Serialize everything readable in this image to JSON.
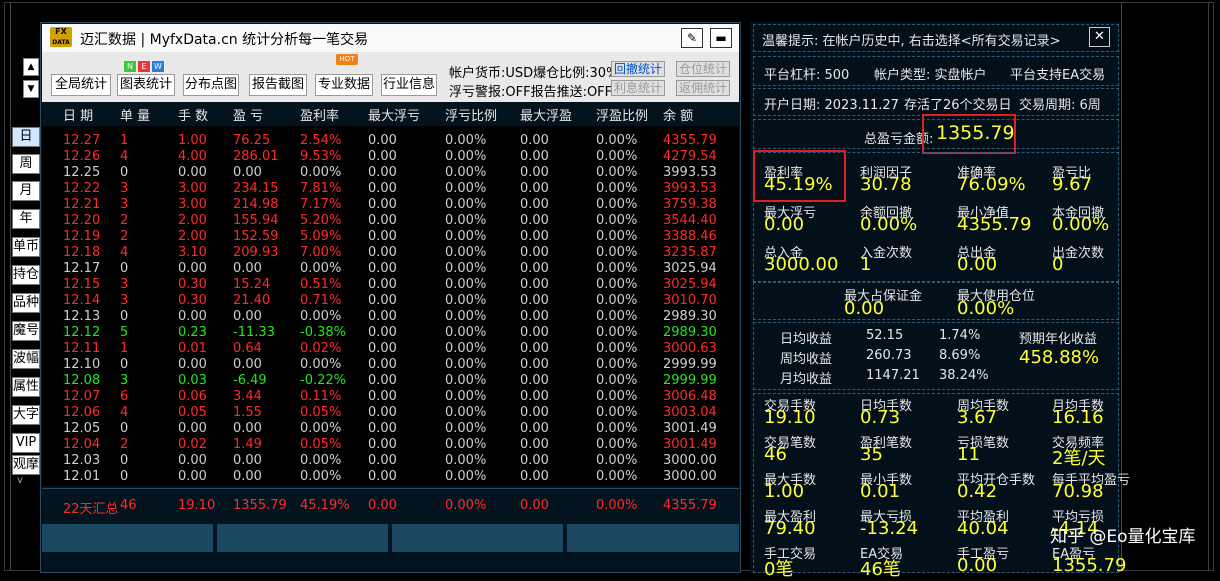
{
  "window": {
    "logo_top": "FX",
    "logo_bottom": "DATA",
    "title": "迈汇数据 | MyfxData.cn  统计分析每一笔交易",
    "edit_icon": "✎",
    "minimize_icon": "▬"
  },
  "toolbar": {
    "buttons": [
      "全局统计",
      "图表统计",
      "分布点图",
      "报告截图",
      "专业数据",
      "行业信息"
    ],
    "new_badges": [
      "N",
      "E",
      "W"
    ],
    "hot_badge": "HOT",
    "account_line1": "帐户货币:USD爆仓比例:30%",
    "account_line2": "浮亏警报:OFF报告推送:OFF",
    "btn_backtest": "回撤统计",
    "btn_position": "仓位统计",
    "btn_profit_info": "利息统计",
    "btn_commission": "返佣统计",
    "up_arrow": "▲",
    "down_arrow": "▼"
  },
  "side_tabs": [
    "日",
    "周",
    "月",
    "年",
    "单币",
    "持仓",
    "品种",
    "魔号",
    "波幅",
    "属性",
    "大字",
    "VIP",
    "观摩"
  ],
  "side_small_arrow": "v",
  "table": {
    "headers": [
      "日 期",
      "单 量",
      "手 数",
      "盈 亏",
      "盈利率",
      "最大浮亏",
      "浮亏比例",
      "最大浮盈",
      "浮盈比例",
      "余 额"
    ],
    "rows": [
      {
        "c": [
          "12.27",
          "1",
          "1.00",
          "76.25",
          "2.54%",
          "0.00",
          "0.00%",
          "0.00",
          "0.00%",
          "4355.79"
        ],
        "t": "red"
      },
      {
        "c": [
          "12.26",
          "4",
          "4.00",
          "286.01",
          "9.53%",
          "0.00",
          "0.00%",
          "0.00",
          "0.00%",
          "4279.54"
        ],
        "t": "red"
      },
      {
        "c": [
          "12.25",
          "0",
          "0.00",
          "0.00",
          "0.00%",
          "0.00",
          "0.00%",
          "0.00",
          "0.00%",
          "3993.53"
        ],
        "t": "white"
      },
      {
        "c": [
          "12.22",
          "3",
          "3.00",
          "234.15",
          "7.81%",
          "0.00",
          "0.00%",
          "0.00",
          "0.00%",
          "3993.53"
        ],
        "t": "red"
      },
      {
        "c": [
          "12.21",
          "3",
          "3.00",
          "214.98",
          "7.17%",
          "0.00",
          "0.00%",
          "0.00",
          "0.00%",
          "3759.38"
        ],
        "t": "red"
      },
      {
        "c": [
          "12.20",
          "2",
          "2.00",
          "155.94",
          "5.20%",
          "0.00",
          "0.00%",
          "0.00",
          "0.00%",
          "3544.40"
        ],
        "t": "red"
      },
      {
        "c": [
          "12.19",
          "2",
          "2.00",
          "152.59",
          "5.09%",
          "0.00",
          "0.00%",
          "0.00",
          "0.00%",
          "3388.46"
        ],
        "t": "red"
      },
      {
        "c": [
          "12.18",
          "4",
          "3.10",
          "209.93",
          "7.00%",
          "0.00",
          "0.00%",
          "0.00",
          "0.00%",
          "3235.87"
        ],
        "t": "red"
      },
      {
        "c": [
          "12.17",
          "0",
          "0.00",
          "0.00",
          "0.00%",
          "0.00",
          "0.00%",
          "0.00",
          "0.00%",
          "3025.94"
        ],
        "t": "white"
      },
      {
        "c": [
          "12.15",
          "3",
          "0.30",
          "15.24",
          "0.51%",
          "0.00",
          "0.00%",
          "0.00",
          "0.00%",
          "3025.94"
        ],
        "t": "red"
      },
      {
        "c": [
          "12.14",
          "3",
          "0.30",
          "21.40",
          "0.71%",
          "0.00",
          "0.00%",
          "0.00",
          "0.00%",
          "3010.70"
        ],
        "t": "red"
      },
      {
        "c": [
          "12.13",
          "0",
          "0.00",
          "0.00",
          "0.00%",
          "0.00",
          "0.00%",
          "0.00",
          "0.00%",
          "2989.30"
        ],
        "t": "white"
      },
      {
        "c": [
          "12.12",
          "5",
          "0.23",
          "-11.33",
          "-0.38%",
          "0.00",
          "0.00%",
          "0.00",
          "0.00%",
          "2989.30"
        ],
        "t": "green"
      },
      {
        "c": [
          "12.11",
          "1",
          "0.01",
          "0.64",
          "0.02%",
          "0.00",
          "0.00%",
          "0.00",
          "0.00%",
          "3000.63"
        ],
        "t": "red"
      },
      {
        "c": [
          "12.10",
          "0",
          "0.00",
          "0.00",
          "0.00%",
          "0.00",
          "0.00%",
          "0.00",
          "0.00%",
          "2999.99"
        ],
        "t": "white"
      },
      {
        "c": [
          "12.08",
          "3",
          "0.03",
          "-6.49",
          "-0.22%",
          "0.00",
          "0.00%",
          "0.00",
          "0.00%",
          "2999.99"
        ],
        "t": "green"
      },
      {
        "c": [
          "12.07",
          "6",
          "0.06",
          "3.44",
          "0.11%",
          "0.00",
          "0.00%",
          "0.00",
          "0.00%",
          "3006.48"
        ],
        "t": "red"
      },
      {
        "c": [
          "12.06",
          "4",
          "0.05",
          "1.55",
          "0.05%",
          "0.00",
          "0.00%",
          "0.00",
          "0.00%",
          "3003.04"
        ],
        "t": "red"
      },
      {
        "c": [
          "12.05",
          "0",
          "0.00",
          "0.00",
          "0.00%",
          "0.00",
          "0.00%",
          "0.00",
          "0.00%",
          "3001.49"
        ],
        "t": "white"
      },
      {
        "c": [
          "12.04",
          "2",
          "0.02",
          "1.49",
          "0.05%",
          "0.00",
          "0.00%",
          "0.00",
          "0.00%",
          "3001.49"
        ],
        "t": "red"
      },
      {
        "c": [
          "12.03",
          "0",
          "0.00",
          "0.00",
          "0.00%",
          "0.00",
          "0.00%",
          "0.00",
          "0.00%",
          "3000.00"
        ],
        "t": "white"
      },
      {
        "c": [
          "12.01",
          "0",
          "0.00",
          "0.00",
          "0.00%",
          "0.00",
          "0.00%",
          "0.00",
          "0.00%",
          "3000.00"
        ],
        "t": "white"
      }
    ],
    "summary": [
      "22天汇总",
      "46",
      "19.10",
      "1355.79",
      "45.19%",
      "0.00",
      "0.00%",
      "0.00",
      "0.00%",
      "4355.79"
    ]
  },
  "right": {
    "tip": "温馨提示: 在帐户历史中, 右击选择<所有交易记录>",
    "close_icon": "✕",
    "leverage": "平台杠杆: 500",
    "account_type": "帐户类型: 实盘帐户",
    "ea_support": "平台支持EA交易",
    "open_date": "开户日期: 2023.11.27",
    "survived": "存活了26个交易日",
    "trade_period": "交易周期: 6周",
    "total_pl_label": "总盈亏金额:",
    "total_pl_value": "1355.79",
    "metrics": [
      {
        "label": "盈利率",
        "value": "45.19%"
      },
      {
        "label": "利润因子",
        "value": "30.78"
      },
      {
        "label": "准确率",
        "value": "76.09%"
      },
      {
        "label": "盈亏比",
        "value": "9.67"
      },
      {
        "label": "最大浮亏",
        "value": "0.00"
      },
      {
        "label": "余额回撤",
        "value": "0.00%"
      },
      {
        "label": "最小净值",
        "value": "4355.79"
      },
      {
        "label": "本金回撤",
        "value": "0.00%"
      },
      {
        "label": "总入金",
        "value": "3000.00"
      },
      {
        "label": "入金次数",
        "value": "1"
      },
      {
        "label": "总出金",
        "value": "0.00"
      },
      {
        "label": "出金次数",
        "value": "0"
      }
    ],
    "margin_max_label": "最大占保证金",
    "margin_max_value": "0.00",
    "max_pos_label": "最大使用仓位",
    "max_pos_value": "0.00%",
    "earnings": [
      {
        "label": "日均收益",
        "amount": "52.15",
        "pct": "1.74%"
      },
      {
        "label": "周均收益",
        "amount": "260.73",
        "pct": "8.69%"
      },
      {
        "label": "月均收益",
        "amount": "1147.21",
        "pct": "38.24%"
      }
    ],
    "forecast_label": "预期年化收益",
    "forecast_value": "458.88%",
    "metrics2": [
      {
        "label": "交易手数",
        "value": "19.10"
      },
      {
        "label": "日均手数",
        "value": "0.73"
      },
      {
        "label": "周均手数",
        "value": "3.67"
      },
      {
        "label": "月均手数",
        "value": "16.16"
      },
      {
        "label": "交易笔数",
        "value": "46"
      },
      {
        "label": "盈利笔数",
        "value": "35"
      },
      {
        "label": "亏损笔数",
        "value": "11"
      },
      {
        "label": "交易频率",
        "value": "2笔/天"
      },
      {
        "label": "最大手数",
        "value": "1.00"
      },
      {
        "label": "最小手数",
        "value": "0.01"
      },
      {
        "label": "平均开仓手数",
        "value": "0.42"
      },
      {
        "label": "每手平均盈亏",
        "value": "70.98"
      },
      {
        "label": "最大盈利",
        "value": "79.40"
      },
      {
        "label": "最大亏损",
        "value": "-13.24"
      },
      {
        "label": "平均盈利",
        "value": "40.04"
      },
      {
        "label": "平均亏损",
        "value": "-4.14"
      },
      {
        "label": "手工交易",
        "value": "0笔"
      },
      {
        "label": "EA交易",
        "value": "46笔"
      },
      {
        "label": "手工盈亏",
        "value": "0.00"
      },
      {
        "label": "EA盈亏",
        "value": "1355.79"
      }
    ]
  },
  "watermark": "知乎 @Eo量化宝库",
  "colors": {
    "profit": "#ff2a2a",
    "loss": "#22e622",
    "flat": "#cfcfcf",
    "highlight": "#ffff33",
    "box": "#e02020"
  }
}
